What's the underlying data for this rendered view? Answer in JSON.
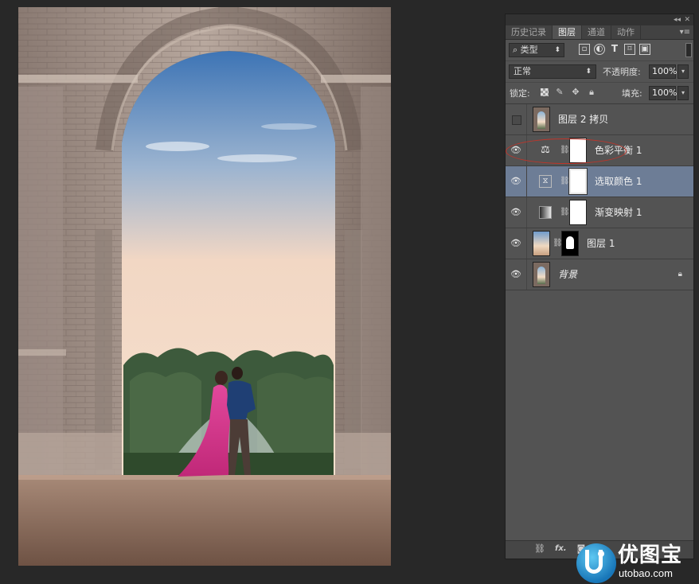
{
  "panel": {
    "collapse_glyph": "◂◂",
    "close_glyph": "✕",
    "menu_glyph": "▾≡",
    "tabs": [
      {
        "label": "历史记录",
        "active": false
      },
      {
        "label": "图层",
        "active": true
      },
      {
        "label": "通道",
        "active": false
      },
      {
        "label": "动作",
        "active": false
      }
    ],
    "filter": {
      "kind_label": "⌕ 类型",
      "icons": [
        "image-filter-icon",
        "adjustment-filter-icon",
        "type-filter-icon",
        "shape-filter-icon",
        "smart-object-filter-icon"
      ],
      "type_glyph": "T"
    },
    "blend": {
      "mode": "正常",
      "opacity_label": "不透明度:",
      "opacity": "100%"
    },
    "lock": {
      "label": "锁定:",
      "fill_label": "填充:",
      "fill": "100%"
    },
    "layers": [
      {
        "name": "图层 2 拷贝",
        "visible": false,
        "kind": "image",
        "thumb": "arch",
        "selected": false
      },
      {
        "name": "色彩平衡 1",
        "visible": true,
        "kind": "adjustment",
        "icon": "color-balance-icon",
        "selected": false,
        "annotated": true
      },
      {
        "name": "选取颜色 1",
        "visible": true,
        "kind": "adjustment",
        "icon": "selective-color-icon",
        "selected": true
      },
      {
        "name": "渐变映射 1",
        "visible": true,
        "kind": "adjustment",
        "icon": "gradient-map-icon",
        "selected": false
      },
      {
        "name": "图层 1",
        "visible": true,
        "kind": "image-mask",
        "thumb": "sky",
        "selected": false
      },
      {
        "name": "背景",
        "visible": true,
        "kind": "background",
        "thumb": "arch",
        "selected": false,
        "locked": true
      }
    ],
    "footer_icons": [
      "link-layers-icon",
      "fx-icon",
      "add-mask-icon",
      "new-adjustment-icon"
    ],
    "fx_label": "fx."
  },
  "watermark": {
    "title": "优图宝",
    "url": "utobao.com"
  },
  "colors": {
    "app_bg": "#282828",
    "panel_bg": "#535353",
    "selected_row": "#6d7d96",
    "annotation": "#c0352a"
  }
}
